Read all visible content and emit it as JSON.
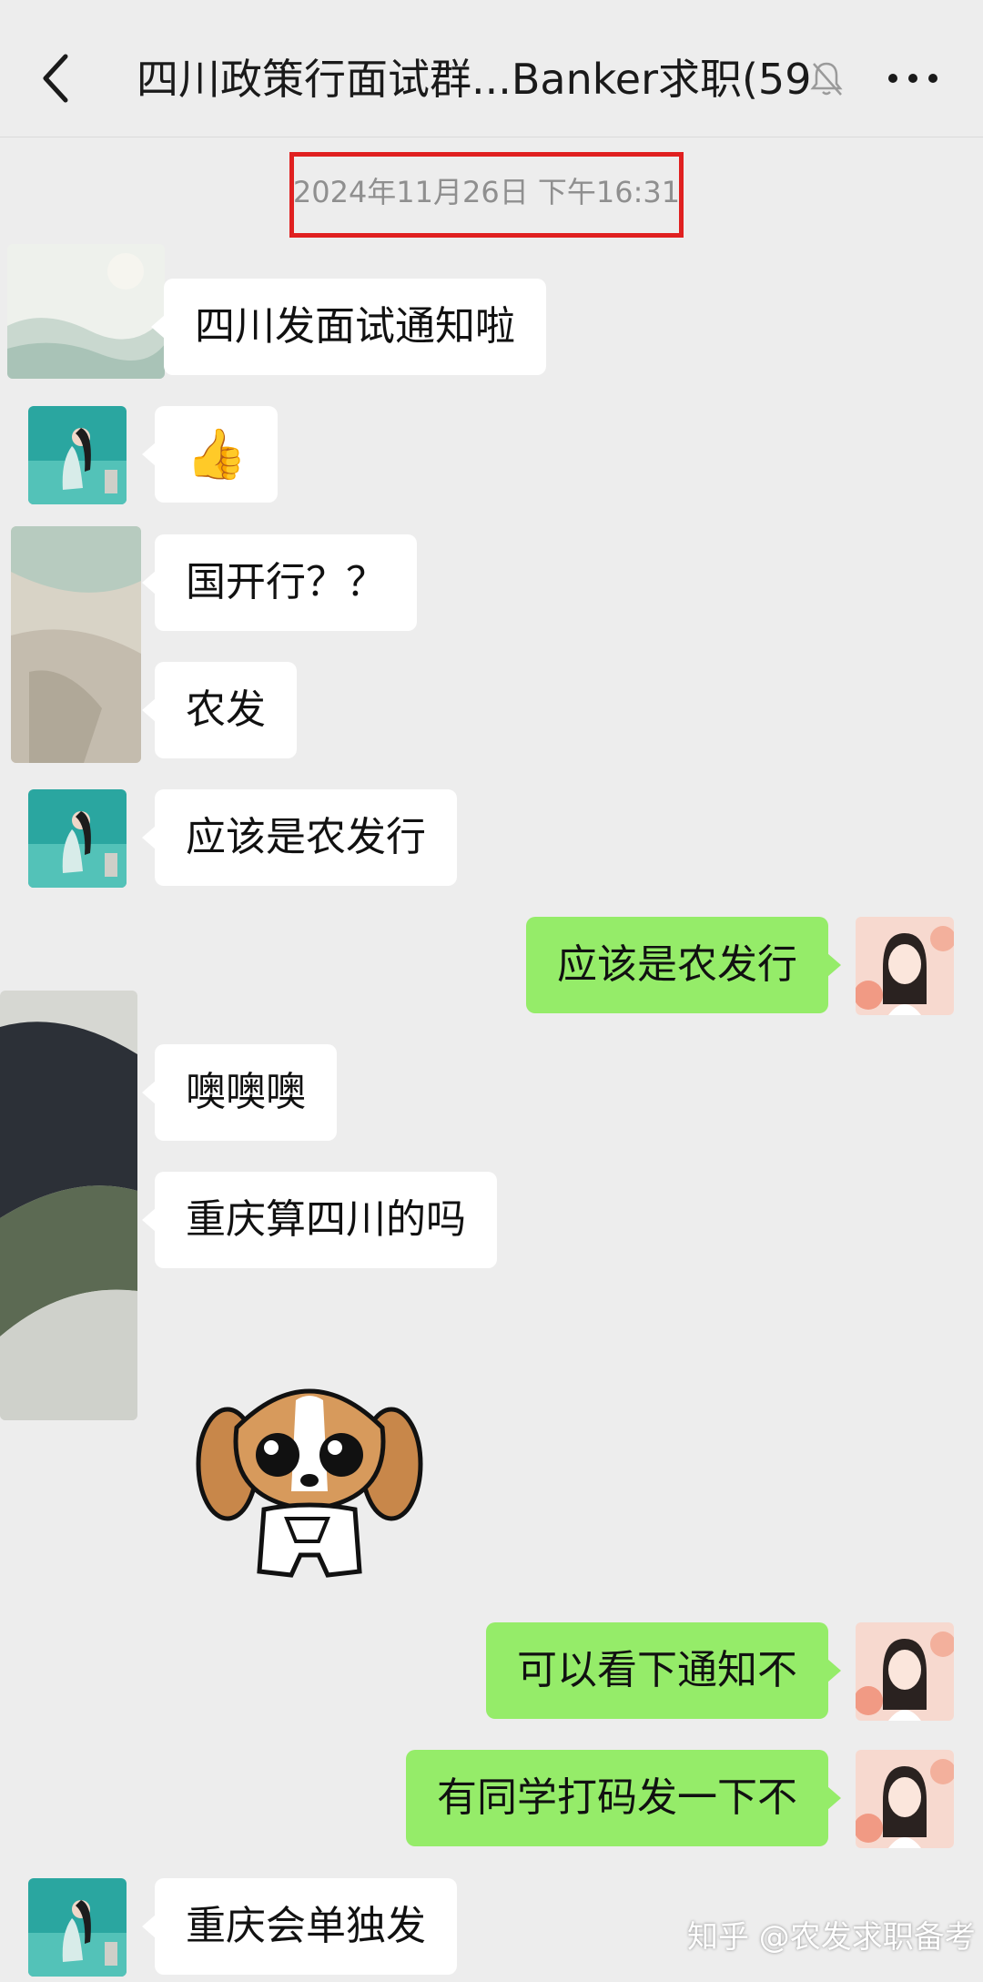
{
  "header": {
    "title": "四川政策行面试群...Banker求职(59)",
    "back_icon": "chevron-left-icon",
    "mute_icon": "bell-off-icon",
    "more_icon": "more-horizontal-icon"
  },
  "timestamp": "2024年11月26日 下午16:31",
  "messages": [
    {
      "side": "left",
      "text": "四川发面试通知啦"
    },
    {
      "side": "left",
      "text": "👍"
    },
    {
      "side": "left",
      "text": "国开行？？"
    },
    {
      "side": "left",
      "text": "农发"
    },
    {
      "side": "left",
      "text": "应该是农发行"
    },
    {
      "side": "right",
      "text": "应该是农发行"
    },
    {
      "side": "left",
      "text": "噢噢噢"
    },
    {
      "side": "left",
      "text": "重庆算四川的吗"
    },
    {
      "side": "left",
      "type": "sticker",
      "sticker": "puppy-sticker"
    },
    {
      "side": "right",
      "text": "可以看下通知不"
    },
    {
      "side": "right",
      "text": "有同学打码发一下不"
    },
    {
      "side": "left",
      "text": "重庆会单独发"
    }
  ],
  "watermark": "知乎 @农发求职备考",
  "colors": {
    "background": "#ededed",
    "bubble_left": "#ffffff",
    "bubble_right": "#95ec69",
    "highlight_box": "#e02020"
  }
}
